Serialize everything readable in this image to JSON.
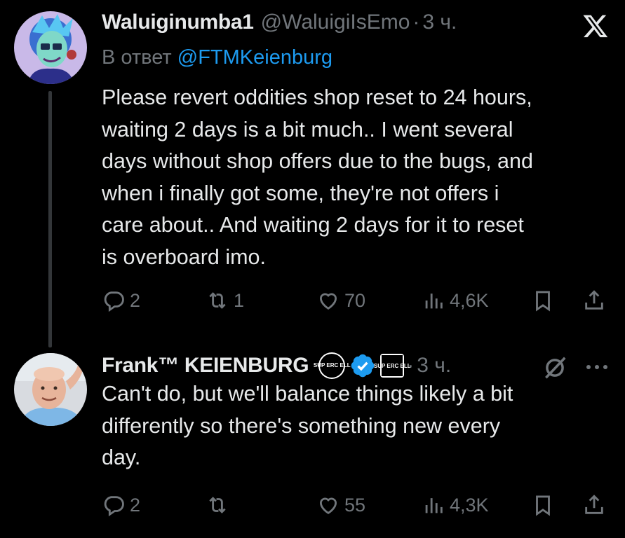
{
  "tweets": [
    {
      "name": "Waluiginumba1",
      "handle": "@WaluigiIsEmo",
      "separator": "·",
      "time": "3 ч.",
      "reply_prefix": "В ответ",
      "reply_mention": "@FTMKeienburg",
      "text": "Please revert oddities shop reset to 24 hours,\nwaiting 2 days is a bit much.. I went several\ndays without shop offers due to the bugs, and\nwhen i finally got some, they're not offers i\ncare about.. And waiting 2 days for it to reset\nis overboard imo.",
      "stats": {
        "replies": "2",
        "reposts": "1",
        "likes": "70",
        "views": "4,6K"
      }
    },
    {
      "name": "Frank™ KEIENBURG",
      "badge_label": "SUP ERC ELL",
      "separator": "·",
      "time": "3 ч.",
      "text": "Can't do, but we'll balance things likely a bit\ndifferently so there's something new every\nday.",
      "stats": {
        "replies": "2",
        "reposts": "",
        "likes": "55",
        "views": "4,3K"
      }
    }
  ],
  "icons": {
    "app_logo": "x-logo-icon",
    "reply": "reply-icon",
    "repost": "repost-icon",
    "like": "heart-icon",
    "views": "views-icon",
    "bookmark": "bookmark-icon",
    "share": "share-icon",
    "verified": "verified-badge-icon",
    "grok": "grok-icon",
    "more": "more-icon"
  },
  "colors": {
    "background": "#000000",
    "text": "#e7e9ea",
    "secondary": "#71767b",
    "accent": "#1d9bf0",
    "thread_line": "#333639"
  }
}
